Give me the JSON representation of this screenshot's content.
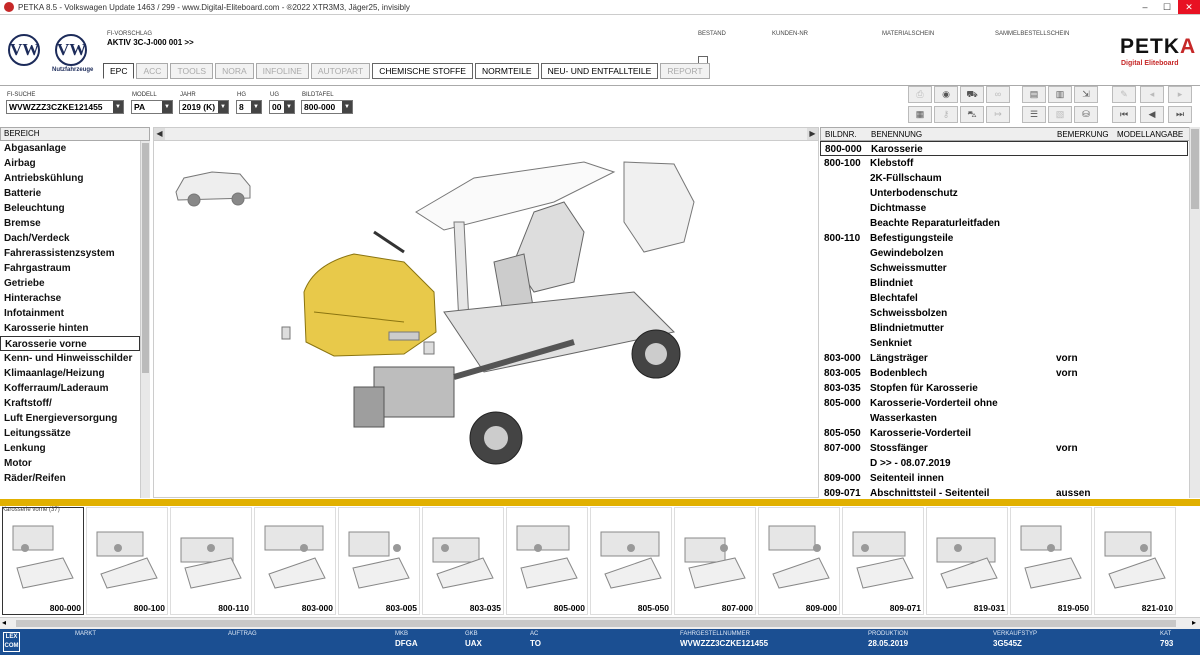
{
  "window": {
    "title": "PETKA 8.5 - Volkswagen Update 1463 / 299 - www.Digital-Eliteboard.com - ®2022 XTR3M3, Jäger25, invisibly",
    "min": "–",
    "max": "☐",
    "close": "✕"
  },
  "header": {
    "logo_letters": "VW",
    "nutzfahrzeuge": "Nutzfahrzeuge",
    "fi_vorschlag_label": "FI-VORSCHLAG",
    "fi_vorschlag_value": "AKTIV  3C-J-000 001 >>",
    "bestand": "BESTAND",
    "kunden_nr": "KUNDEN-NR",
    "materialschein": "MATERIALSCHEIN",
    "sammelbestellschein": "SAMMELBESTELLSCHEIN",
    "brand_a": "PETK",
    "brand_b": "A",
    "brand_sub": "Digital Eliteboard"
  },
  "tabs": [
    "EPC",
    "ACC",
    "TOOLS",
    "NORA",
    "INFOLINE",
    "AUTOPART",
    "CHEMISCHE STOFFE",
    "NORMTEILE",
    "NEU- UND ENTFALLTEILE",
    "REPORT"
  ],
  "filters": {
    "fi_suche_label": "FI-SUCHE",
    "fi_suche": "WVWZZZ3CZKE121455",
    "modell_label": "MODELL",
    "modell": "PA",
    "jahr_label": "JAHR",
    "jahr": "2019 (K)",
    "hg_label": "HG",
    "hg": "8",
    "ug_label": "UG",
    "ug": "00",
    "bildtafel_label": "BILDTAFEL",
    "bildtafel": "800-000"
  },
  "toolbar_icons": [
    "printer-icon",
    "cd-icon",
    "car-icon",
    "glasses-icon",
    "card-icon",
    "card2-icon",
    "cart-icon",
    "pin-icon",
    "prev-icon",
    "first-icon",
    "keyboard-icon",
    "key-icon",
    "car-front-icon",
    "arrow-icon",
    "list-icon",
    "image-list-icon",
    "cart-add-icon",
    "next-icon",
    "last-icon"
  ],
  "bereich": {
    "header": "BEREICH",
    "items": [
      "Abgasanlage",
      "Airbag",
      "Antriebskühlung",
      "Batterie",
      "Beleuchtung",
      "Bremse",
      "Dach/Verdeck",
      "Fahrerassistenzsystem",
      "Fahrgastraum",
      "Getriebe",
      "Hinterachse",
      "Infotainment",
      "Karosserie hinten",
      "Karosserie vorne",
      "Kenn- und Hinweisschilder",
      "Klimaanlage/Heizung",
      "Kofferraum/Laderaum",
      "Kraftstoff/",
      "Luft Energieversorgung",
      "Leitungssätze",
      "Lenkung",
      "Motor",
      "Räder/Reifen"
    ],
    "selected": 13
  },
  "parts": {
    "headers": {
      "bildnr": "BILDNR.",
      "benennung": "BENENNUNG",
      "bemerkung": "BEMERKUNG",
      "modellangabe": "MODELLANGABE"
    },
    "rows": [
      {
        "nr": "800-000",
        "name": "Karosserie",
        "rem": "",
        "sel": true
      },
      {
        "nr": "800-100",
        "name": "Klebstoff",
        "rem": ""
      },
      {
        "nr": "",
        "name": "2K-Füllschaum",
        "rem": ""
      },
      {
        "nr": "",
        "name": "Unterbodenschutz",
        "rem": ""
      },
      {
        "nr": "",
        "name": "Dichtmasse",
        "rem": ""
      },
      {
        "nr": "",
        "name": "Beachte Reparaturleitfaden",
        "rem": ""
      },
      {
        "nr": "800-110",
        "name": "Befestigungsteile",
        "rem": ""
      },
      {
        "nr": "",
        "name": "Gewindebolzen",
        "rem": ""
      },
      {
        "nr": "",
        "name": "Schweissmutter",
        "rem": ""
      },
      {
        "nr": "",
        "name": "Blindniet",
        "rem": ""
      },
      {
        "nr": "",
        "name": "Blechtafel",
        "rem": ""
      },
      {
        "nr": "",
        "name": "Schweissbolzen",
        "rem": ""
      },
      {
        "nr": "",
        "name": "Blindnietmutter",
        "rem": ""
      },
      {
        "nr": "",
        "name": "Senkniet",
        "rem": ""
      },
      {
        "nr": "803-000",
        "name": "Längsträger",
        "rem": "vorn"
      },
      {
        "nr": "803-005",
        "name": "Bodenblech",
        "rem": "vorn"
      },
      {
        "nr": "803-035",
        "name": "Stopfen für Karosserie",
        "rem": ""
      },
      {
        "nr": "805-000",
        "name": "Karosserie-Vorderteil ohne",
        "rem": ""
      },
      {
        "nr": "",
        "name": "Wasserkasten",
        "rem": ""
      },
      {
        "nr": "805-050",
        "name": "Karosserie-Vorderteil",
        "rem": ""
      },
      {
        "nr": "807-000",
        "name": "Stossfänger",
        "rem": "vorn"
      },
      {
        "nr": "",
        "name": "D          >> - 08.07.2019",
        "rem": ""
      },
      {
        "nr": "809-000",
        "name": "Seitenteil innen",
        "rem": ""
      },
      {
        "nr": "809-071",
        "name": "Abschnittsteil - Seitenteil",
        "rem": "aussen"
      }
    ]
  },
  "thumbs": {
    "caption": "Karosserie vorne (37)",
    "items": [
      "800-000",
      "800-100",
      "800-110",
      "803-000",
      "803-005",
      "803-035",
      "805-000",
      "805-050",
      "807-000",
      "809-000",
      "809-071",
      "819-031",
      "819-050",
      "821-010"
    ]
  },
  "status": {
    "lexcom": "LEX COM",
    "markt_label": "MARKT",
    "auftrag_label": "AUFTRAG",
    "mkb_label": "MKB",
    "mkb": "DFGA",
    "gkb_label": "GKB",
    "gkb": "UAX",
    "ac_label": "AC",
    "ac": "TO",
    "fin_label": "FAHRGESTELLNUMMER",
    "fin": "WVWZZZ3CZKE121455",
    "produktion_label": "PRODUKTION",
    "produktion": "28.05.2019",
    "verkaufstyp_label": "VERKAUFSTYP",
    "verkaufstyp": "3G545Z",
    "kat_label": "KAT",
    "kat": "793"
  },
  "colors": {
    "accent": "#e1b000",
    "statusbar": "#1b4f92",
    "brand_red": "#c62828",
    "highlight": "#e8c94a"
  }
}
